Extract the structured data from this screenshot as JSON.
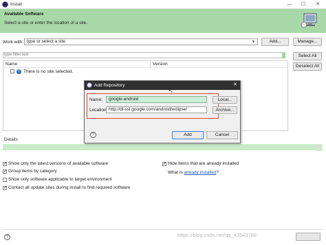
{
  "window": {
    "title": "Install"
  },
  "banner": {
    "heading": "Available Software",
    "subtitle": "Select a site or enter the location of a site."
  },
  "work_with": {
    "label": "Work with:",
    "placeholder": "type or select a site",
    "add_label": "Add...",
    "manage_label": "Manage..."
  },
  "filter": {
    "placeholder": "type filter text"
  },
  "table": {
    "col_name": "Name",
    "col_version": "Version",
    "empty_message": "There is no site selected."
  },
  "side_buttons": {
    "select_all": "Select All",
    "deselect_all": "Deselect All"
  },
  "details": {
    "label": "Details"
  },
  "options": {
    "show_latest": "Show only the latest versions of available software",
    "group_by_category": "Group items by category",
    "show_applicable": "Show only software applicable to target environment",
    "contact_sites": "Contact all update sites during install to find required software",
    "hide_installed": "Hide items that are already installed",
    "what_is_prefix": "What is",
    "already_installed_link": "already installed",
    "what_is_suffix": "?"
  },
  "dialog": {
    "title": "Add Repository",
    "name_label": "Name:",
    "name_value": "google-android",
    "location_label": "Location:",
    "location_value": "http://dl-ssl.google.com/android/eclipse/",
    "local_label": "Local...",
    "archive_label": "Archive...",
    "add_label": "Add",
    "cancel_label": "Cancel"
  },
  "watermark": "https://blog.csdn.net/qq_43543789",
  "colors": {
    "banner": "#a8d8a8",
    "dialog_title": "#2f2f2f",
    "highlight_border": "#e2443a",
    "link": "#1a56b8"
  }
}
